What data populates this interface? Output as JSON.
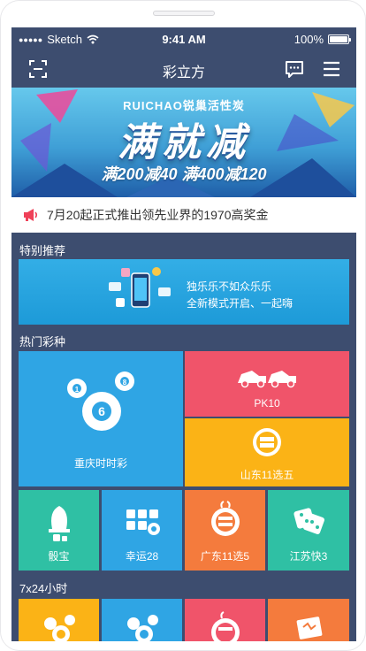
{
  "status_bar": {
    "carrier": "Sketch",
    "time": "9:41 AM",
    "battery": "100%",
    "battery_level": 1.0
  },
  "nav": {
    "title": "彩立方",
    "left_icon": "scan-icon",
    "right_icons": [
      "message-icon",
      "menu-icon"
    ]
  },
  "banner": {
    "brand": "RUICHAO锐巢活性炭",
    "headline": "满就减",
    "offer": "满200减40  满400减120"
  },
  "notice": {
    "text": "7月20起正式推出领先业界的1970高奖金",
    "icon": "megaphone-icon"
  },
  "sections": {
    "special": "特别推荐",
    "hot": "热门彩种",
    "all_day": "7x24小时"
  },
  "special_card": {
    "line1": "独乐乐不如众乐乐",
    "line2": "全新模式开启、一起嗨"
  },
  "hot_games": [
    {
      "name": "重庆时时彩",
      "color": "#2fa5e4",
      "icon": "lottery-balls-icon"
    },
    {
      "name": "PK10",
      "color": "#f0546a",
      "icon": "race-cars-icon"
    },
    {
      "name": "山东11选五",
      "color": "#fbb316",
      "icon": "shandong-11-5-icon"
    },
    {
      "name": "骰宝",
      "color": "#2fc0a4",
      "icon": "dice-cup-icon"
    },
    {
      "name": "幸运28",
      "color": "#2fa5e4",
      "icon": "lucky-grid-icon"
    },
    {
      "name": "广东11选5",
      "color": "#f47b3d",
      "icon": "guangdong-11-5-icon"
    },
    {
      "name": "江苏快3",
      "color": "#2fc0a4",
      "icon": "jiangsu-dice-icon"
    }
  ],
  "all_day_tiles": [
    {
      "color": "#fbb316",
      "icon": "balls-icon"
    },
    {
      "color": "#2fa5e4",
      "icon": "balls-icon"
    },
    {
      "color": "#f0546a",
      "icon": "anhui-11-5-icon"
    },
    {
      "color": "#f47b3d",
      "icon": "ticket-icon"
    }
  ]
}
